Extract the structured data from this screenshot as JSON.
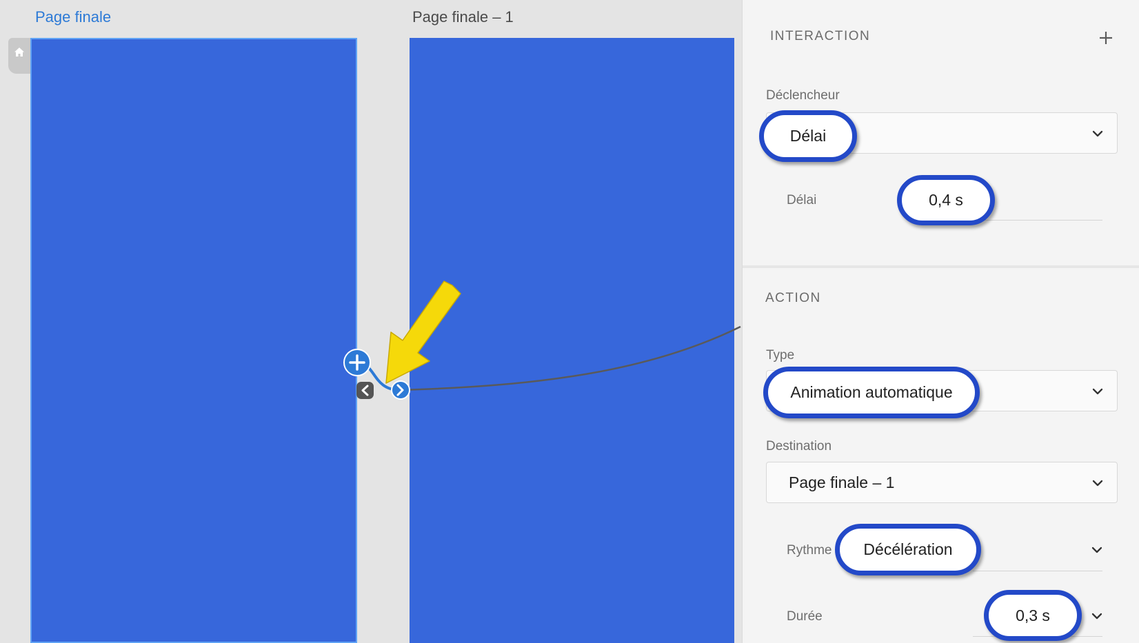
{
  "canvas": {
    "artboards": [
      {
        "title": "Page finale",
        "active": true
      },
      {
        "title": "Page finale – 1",
        "active": false
      }
    ],
    "home_icon": "home-icon",
    "connector_icons": [
      "add-interaction-icon",
      "back-arrow-icon",
      "forward-arrow-icon"
    ],
    "annotation": "yellow-arrow-icon"
  },
  "panel": {
    "interaction": {
      "title": "INTERACTION",
      "add_icon": "plus-icon",
      "trigger_label": "Déclencheur",
      "trigger_value": "Délai",
      "delay_label": "Délai",
      "delay_value": "0,4 s"
    },
    "action": {
      "title": "ACTION",
      "type_label": "Type",
      "type_value": "Animation automatique",
      "destination_label": "Destination",
      "destination_value": "Page finale – 1",
      "easing_label": "Rythme",
      "easing_value": "Décélération",
      "duration_label": "Durée",
      "duration_value": "0,3 s"
    }
  },
  "colors": {
    "artboard": "#3767db",
    "accent": "#2d7ad6",
    "highlight_ring": "#2349c8",
    "annotation_arrow": "#f5d90a"
  }
}
